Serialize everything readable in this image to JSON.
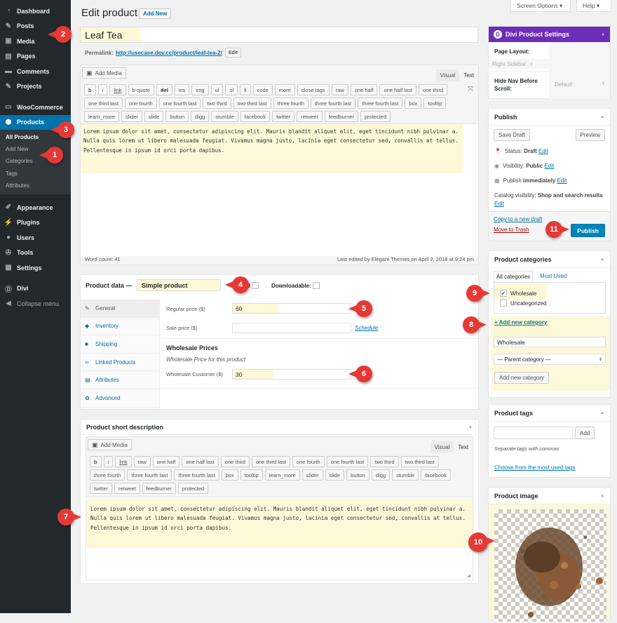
{
  "sidebar": {
    "items": [
      {
        "label": "Dashboard",
        "icon": "dashboard-icon",
        "glyph": "◔"
      },
      {
        "label": "Posts",
        "icon": "pin-icon",
        "glyph": "✎"
      },
      {
        "label": "Media",
        "icon": "media-icon",
        "glyph": "▣"
      },
      {
        "label": "Pages",
        "icon": "pages-icon",
        "glyph": "▤"
      },
      {
        "label": "Comments",
        "icon": "comment-icon",
        "glyph": "▬"
      },
      {
        "label": "Projects",
        "icon": "pin-icon",
        "glyph": "✎"
      },
      {
        "label": "WooCommerce",
        "icon": "woocommerce-icon",
        "glyph": "▭"
      },
      {
        "label": "Products",
        "icon": "box-icon",
        "glyph": "⬢"
      }
    ],
    "submenu": [
      "All Products",
      "Add New",
      "Categories",
      "Tags",
      "Attributes"
    ],
    "items2": [
      {
        "label": "Appearance",
        "icon": "brush-icon",
        "glyph": "✐"
      },
      {
        "label": "Plugins",
        "icon": "plug-icon",
        "glyph": "⚡"
      },
      {
        "label": "Users",
        "icon": "user-icon",
        "glyph": "●"
      },
      {
        "label": "Tools",
        "icon": "wrench-icon",
        "glyph": "✇"
      },
      {
        "label": "Settings",
        "icon": "settings-icon",
        "glyph": "▦"
      },
      {
        "label": "Divi",
        "icon": "divi-icon",
        "glyph": "Ⓓ"
      },
      {
        "label": "Collapse menu",
        "icon": "collapse-icon",
        "glyph": "◀"
      }
    ]
  },
  "header": {
    "title": "Edit product",
    "add_new": "Add New",
    "screen_options": "Screen Options ▾",
    "help": "Help ▾"
  },
  "post": {
    "title": "Leaf Tea",
    "permalink_label": "Permalink:",
    "permalink_url": "http://usecase.dev.cc/product/leaf-tea-2/",
    "permalink_edit": "Edit"
  },
  "editor": {
    "add_media": "Add Media",
    "tab_visual": "Visual",
    "tab_text": "Text",
    "quicktags": [
      "b",
      "i",
      "link",
      "b-quote",
      "del",
      "ins",
      "img",
      "ul",
      "ol",
      "li",
      "code",
      "more",
      "close tags",
      "raw",
      "one half",
      "one half last",
      "one third",
      "one third last",
      "one fourth",
      "one fourth last",
      "two third",
      "two third last",
      "three fourth",
      "three fourth last",
      "three fourth last",
      "box",
      "tooltip",
      "learn_more",
      "slider",
      "slide",
      "button",
      "digg",
      "stumble",
      "facebook",
      "twitter",
      "retweet",
      "feedburner",
      "protected"
    ],
    "content": "Lorem ipsum dolor sit amet, consectetur adipiscing elit. Mauris blandit aliquet elit, eget tincidunt nibh pulvinar a. Nulla quis lorem ut libero malesuada feugiat. Vivamus magna justo, lacinia eget consectetur sed, convallis at tellus. Pellentesque in ipsum id orci porta dapibus.",
    "word_count": "Word count: 41",
    "last_edited": "Last edited by Elegant Themes on April 2, 2018 at 9:24 pm"
  },
  "product_data": {
    "label": "Product data —",
    "type": "Simple product",
    "virtual_label": "Virtual:",
    "downloadable_label": "Downloadable:",
    "tabs": [
      {
        "label": "General",
        "glyph": "✎"
      },
      {
        "label": "Inventory",
        "glyph": "◆"
      },
      {
        "label": "Shipping",
        "glyph": "■"
      },
      {
        "label": "Linked Products",
        "glyph": "∞"
      },
      {
        "label": "Attributes",
        "glyph": "▤"
      },
      {
        "label": "Advanced",
        "glyph": "✿"
      }
    ],
    "regular_price_label": "Regular price ($)",
    "regular_price": "60",
    "sale_price_label": "Sale price ($)",
    "sale_price": "",
    "schedule": "Schedule",
    "wholesale_heading": "Wholesale Prices",
    "wholesale_desc": "Wholesale Price for this product",
    "wholesale_customer_label": "Wholesale Customer ($)",
    "wholesale_customer": "30"
  },
  "short_description": {
    "title": "Product short description",
    "add_media": "Add Media",
    "tab_visual": "Visual",
    "tab_text": "Text",
    "quicktags": [
      "b",
      "i",
      "link",
      "raw",
      "one half",
      "one half last",
      "one third",
      "one third last",
      "one fourth",
      "one fourth last",
      "two third",
      "two third last",
      "three fourth",
      "three fourth last",
      "three fourth last",
      "box",
      "tooltip",
      "learn_more",
      "slider",
      "slide",
      "button",
      "digg",
      "stumble",
      "facebook",
      "twitter",
      "retweet",
      "feedburner",
      "protected"
    ],
    "content": "Lorem ipsum dolor sit amet, consectetur adipiscing elit. Mauris blandit aliquet elit, eget tincidunt nibh pulvinar a. Nulla quis lorem ut libero malesuada feugiat. Vivamus magna justo, lacinia eget consectetur sed, convallis at tellus. Pellentesque in ipsum id orci porta dapibus."
  },
  "divi": {
    "title": "Divi Product Settings",
    "page_layout_label": "Page Layout:",
    "page_layout": "Right Sidebar",
    "hide_nav_label": "Hide Nav Before Scroll:",
    "hide_nav": "Default",
    "color": "#6c2eb9"
  },
  "publish": {
    "title": "Publish",
    "save_draft": "Save Draft",
    "preview": "Preview",
    "status_label": "Status:",
    "status": "Draft",
    "visibility_label": "Visibility:",
    "visibility": "Public",
    "publish_label": "Publish",
    "publish_when": "immediately",
    "catalog_label": "Catalog visibility:",
    "catalog": "Shop and search results",
    "edit": "Edit",
    "copy_draft": "Copy to a new draft",
    "trash": "Move to Trash",
    "publish_btn": "Publish",
    "color": "#0085ba"
  },
  "categories": {
    "title": "Product categories",
    "tab_all": "All categories",
    "tab_most": "Most Used",
    "items": [
      {
        "label": "Wholesale",
        "checked": true
      },
      {
        "label": "Uncategorized",
        "checked": false
      }
    ],
    "add_link": "+ Add new category",
    "new_name": "Wholesale",
    "parent": "— Parent category —",
    "add_btn": "Add new category"
  },
  "tags": {
    "title": "Product tags",
    "input": "",
    "add": "Add",
    "hint": "Separate tags with commas",
    "choose": "Choose from the most used tags"
  },
  "image": {
    "title": "Product image"
  },
  "markers": [
    "1",
    "2",
    "3",
    "4",
    "5",
    "6",
    "7",
    "8",
    "9",
    "10",
    "11"
  ]
}
